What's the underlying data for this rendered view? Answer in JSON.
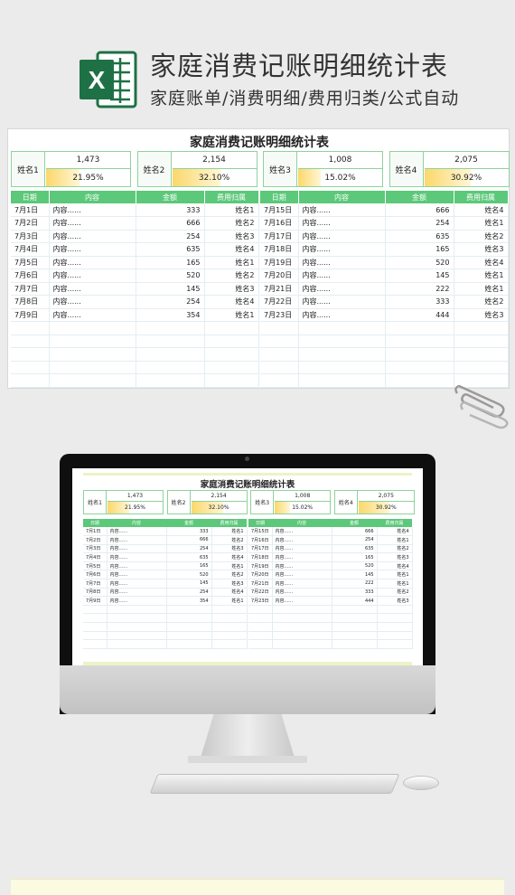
{
  "header": {
    "title": "家庭消费记账明细统计表",
    "subtitle": "家庭账单/消费明细/费用归类/公式自动",
    "logo_letter": "X"
  },
  "sheet": {
    "title": "家庭消费记账明细统计表",
    "summary": [
      {
        "name": "姓名1",
        "amount": "1,473",
        "percent_label": "21.95%",
        "percent": 21.95
      },
      {
        "name": "姓名2",
        "amount": "2,154",
        "percent_label": "32.10%",
        "percent": 32.1
      },
      {
        "name": "姓名3",
        "amount": "1,008",
        "percent_label": "15.02%",
        "percent": 15.02
      },
      {
        "name": "姓名4",
        "amount": "2,075",
        "percent_label": "30.92%",
        "percent": 30.92
      }
    ],
    "columns": [
      "日期",
      "内容",
      "金额",
      "费用归属"
    ],
    "left_rows": [
      [
        "7月1日",
        "内容......",
        "333",
        "姓名1"
      ],
      [
        "7月2日",
        "内容......",
        "666",
        "姓名2"
      ],
      [
        "7月3日",
        "内容......",
        "254",
        "姓名3"
      ],
      [
        "7月4日",
        "内容......",
        "635",
        "姓名4"
      ],
      [
        "7月5日",
        "内容......",
        "165",
        "姓名1"
      ],
      [
        "7月6日",
        "内容......",
        "520",
        "姓名2"
      ],
      [
        "7月7日",
        "内容......",
        "145",
        "姓名3"
      ],
      [
        "7月8日",
        "内容......",
        "254",
        "姓名4"
      ],
      [
        "7月9日",
        "内容......",
        "354",
        "姓名1"
      ]
    ],
    "right_rows": [
      [
        "7月15日",
        "内容......",
        "666",
        "姓名4"
      ],
      [
        "7月16日",
        "内容......",
        "254",
        "姓名1"
      ],
      [
        "7月17日",
        "内容......",
        "635",
        "姓名2"
      ],
      [
        "7月18日",
        "内容......",
        "165",
        "姓名3"
      ],
      [
        "7月19日",
        "内容......",
        "520",
        "姓名4"
      ],
      [
        "7月20日",
        "内容......",
        "145",
        "姓名1"
      ],
      [
        "7月21日",
        "内容......",
        "222",
        "姓名1"
      ],
      [
        "7月22日",
        "内容......",
        "333",
        "姓名2"
      ],
      [
        "7月23日",
        "内容......",
        "444",
        "姓名3"
      ]
    ],
    "empty_rows": 5
  },
  "colors": {
    "header_green": "#5cc879",
    "card_border": "#8fd19e",
    "bar_yellow": "#fbd86b",
    "excel_green": "#1e7145"
  }
}
